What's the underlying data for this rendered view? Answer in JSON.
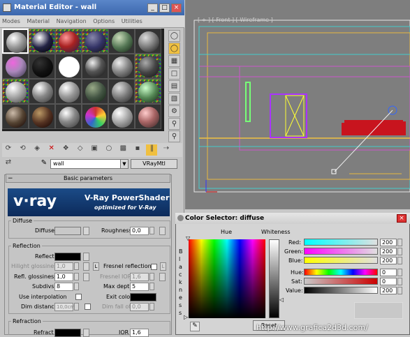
{
  "material_editor": {
    "title": "Material Editor - wall",
    "menu": [
      "Modes",
      "Material",
      "Navigation",
      "Options",
      "Utilities"
    ],
    "title_buttons": [
      "_",
      "□",
      "×"
    ],
    "material_name": "wall",
    "material_type": "VRayMtl",
    "rollout_title": "Basic parameters",
    "banner_logo": "v·ray",
    "banner_title": "V-Ray PowerShader",
    "banner_subtitle": "optimized for V-Ray",
    "diffuse": {
      "group": "Diffuse",
      "diffuse_label": "Diffuse",
      "roughness_label": "Roughness",
      "roughness_value": "0,0"
    },
    "reflection": {
      "group": "Reflection",
      "reflect_label": "Reflect",
      "hilight_label": "Hilight glossiness",
      "hilight_value": "1,0",
      "l_button": "L",
      "fresnel_label": "Fresnel reflections",
      "refl_gloss_label": "Refl. glossiness",
      "refl_gloss_value": "1,0",
      "fresnel_ior_label": "Fresnel IOR",
      "fresnel_ior_value": "1,6",
      "subdivs_label": "Subdivs",
      "subdivs_value": "8",
      "max_depth_label": "Max depth",
      "max_depth_value": "5",
      "use_interp_label": "Use interpolation",
      "exit_color_label": "Exit color",
      "dim_distance_label": "Dim distance",
      "dim_distance_value": "10,0cm",
      "dim_falloff_label": "Dim fall off",
      "dim_falloff_value": "0,0"
    },
    "refraction": {
      "group": "Refraction",
      "refract_label": "Refract",
      "ior_label": "IOR",
      "ior_value": "1,6"
    }
  },
  "viewport": {
    "label": "[ + ] [ Front ] [ Wireframe ]"
  },
  "color_selector": {
    "title": "Color Selector: diffuse",
    "close": "×",
    "hue_label": "Hue",
    "whiteness_label": "Whiteness",
    "blackness_label": "B l a c k n e s s",
    "red_label": "Red:",
    "red_value": "200",
    "green_label": "Green:",
    "green_value": "200",
    "blue_label": "Blue:",
    "blue_value": "200",
    "hue_value_label": "Hue:",
    "hue_value": "0",
    "sat_label": "Sat:",
    "sat_value": "0",
    "value_label": "Value:",
    "value_value": "200",
    "reset_button": "Reset"
  },
  "watermark": "http://www.grafica2d3d.com/",
  "colors": {
    "title_blue": "#3c67ad",
    "viewport_bg": "#7e7e7e",
    "swatch_diffuse": "#c8c8c8",
    "object_red": "#c8141e"
  }
}
